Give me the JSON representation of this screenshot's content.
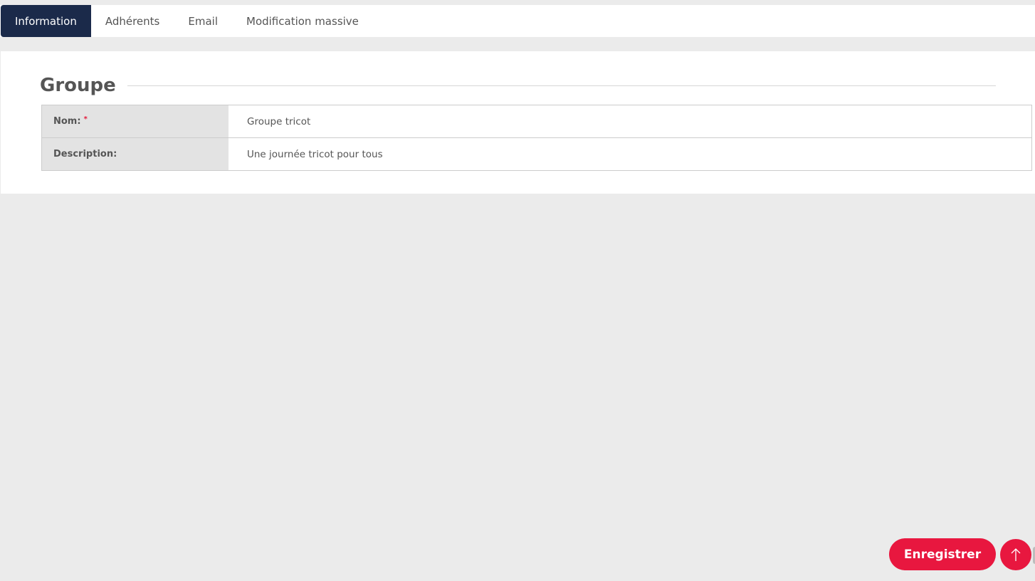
{
  "tabs": [
    {
      "label": "Information",
      "active": true
    },
    {
      "label": "Adhérents",
      "active": false
    },
    {
      "label": "Email",
      "active": false
    },
    {
      "label": "Modification massive",
      "active": false
    }
  ],
  "section": {
    "title": "Groupe"
  },
  "form": {
    "rows": [
      {
        "label": "Nom:",
        "required_mark": "*",
        "value": "Groupe tricot"
      },
      {
        "label": "Description:",
        "value": "Une journée tricot pour tous"
      }
    ]
  },
  "actions": {
    "save_label": "Enregistrer",
    "scroll_top_icon": "arrow-up-icon"
  },
  "colors": {
    "active_tab": "#1b2a4a",
    "accent": "#e8173f",
    "background": "#ebebeb"
  }
}
